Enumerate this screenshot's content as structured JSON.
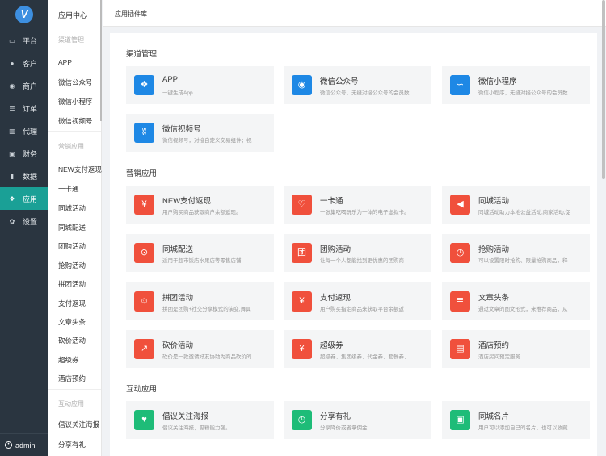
{
  "logo": {
    "text": "V"
  },
  "main_nav": [
    {
      "label": "平台",
      "icon": "monitor-icon"
    },
    {
      "label": "客户",
      "icon": "user-icon"
    },
    {
      "label": "商户",
      "icon": "users-icon"
    },
    {
      "label": "订单",
      "icon": "list-icon"
    },
    {
      "label": "代理",
      "icon": "map-icon"
    },
    {
      "label": "财务",
      "icon": "wallet-icon"
    },
    {
      "label": "数据",
      "icon": "bar-chart-icon"
    },
    {
      "label": "应用",
      "icon": "cubes-icon",
      "active": true
    },
    {
      "label": "设置",
      "icon": "gear-icon"
    }
  ],
  "user": {
    "name": "admin"
  },
  "sub_nav": {
    "title": "应用中心",
    "groups": [
      {
        "label": "渠道管理",
        "items": [
          "APP",
          "微信公众号",
          "微信小程序",
          "微信视频号"
        ]
      },
      {
        "label": "营销应用",
        "items": [
          "NEW支付返现",
          "一卡通",
          "同城活动",
          "同城配送",
          "团购活动",
          "抢购活动",
          "拼团活动",
          "支付返现",
          "文章头条",
          "砍价活动",
          "超级券",
          "酒店预约"
        ]
      },
      {
        "label": "互动应用",
        "items": [
          "倡议关注海报",
          "分享有礼"
        ]
      }
    ]
  },
  "topbar": {
    "title": "应用插件库"
  },
  "sections": [
    {
      "title": "渠道管理",
      "cards": [
        {
          "name": "APP",
          "desc": "一键生成App",
          "icon": "grid-icon",
          "color": "blue",
          "glyph": "❖"
        },
        {
          "name": "微信公众号",
          "desc": "微信公众号，无缝对接公众号的会员数",
          "icon": "wechat-icon",
          "color": "blue",
          "glyph": "◉"
        },
        {
          "name": "微信小程序",
          "desc": "微信小程序，无缝对接公众号的会员数",
          "icon": "mini-program-icon",
          "color": "blue",
          "glyph": "∽"
        },
        {
          "name": "微信视频号",
          "desc": "微信视频号，对接自定义交易组件；视",
          "icon": "channels-icon",
          "color": "blue",
          "glyph": "ʬ"
        }
      ]
    },
    {
      "title": "营销应用",
      "cards": [
        {
          "name": "NEW支付返现",
          "desc": "用户购买商品获取商户余额返现。",
          "icon": "money-bag-icon",
          "color": "red",
          "glyph": "¥"
        },
        {
          "name": "一卡通",
          "desc": "一张集吃喝玩乐为一体的电子虚拟卡。",
          "icon": "heart-card-icon",
          "color": "red",
          "glyph": "♡"
        },
        {
          "name": "同城活动",
          "desc": "同城活动助力本地公益活动,商家活动,促",
          "icon": "megaphone-icon",
          "color": "red",
          "glyph": "◀"
        },
        {
          "name": "同城配送",
          "desc": "适用于超市饭店水果店等零售店铺",
          "icon": "scooter-icon",
          "color": "red",
          "glyph": "⊙"
        },
        {
          "name": "团购活动",
          "desc": "让每一个人都能找到更优惠的团购商",
          "icon": "group-buy-icon",
          "color": "red",
          "glyph": "团"
        },
        {
          "name": "抢购活动",
          "desc": "可以设置限时抢购、限量抢购商品，释",
          "icon": "timer-icon",
          "color": "red",
          "glyph": "◷"
        },
        {
          "name": "拼团活动",
          "desc": "拼团是团购+社交分享模式的演变,舞具",
          "icon": "people-icon",
          "color": "red",
          "glyph": "☺"
        },
        {
          "name": "支付返现",
          "desc": "用户购买指定商品来获取平台余额返",
          "icon": "cash-bag-icon",
          "color": "red",
          "glyph": "¥"
        },
        {
          "name": "文章头条",
          "desc": "通过文章的图文形式，来推荐商品，从",
          "icon": "article-icon",
          "color": "red",
          "glyph": "≣"
        },
        {
          "name": "砍价活动",
          "desc": "砍价是一款邀请好友协助为商品砍价的",
          "icon": "knife-icon",
          "color": "red",
          "glyph": "↗"
        },
        {
          "name": "超级券",
          "desc": "超级券、集团级券、代金券、套餐券、",
          "icon": "coupon-icon",
          "color": "red",
          "glyph": "¥"
        },
        {
          "name": "酒店预约",
          "desc": "酒店房间预定服务",
          "icon": "hotel-icon",
          "color": "red",
          "glyph": "▤"
        }
      ]
    },
    {
      "title": "互动应用",
      "cards": [
        {
          "name": "倡议关注海报",
          "desc": "倡议关注海报，吸粉能力强。",
          "icon": "heart-icon",
          "color": "green",
          "glyph": "♥"
        },
        {
          "name": "分享有礼",
          "desc": "分享降价或者拿佣金",
          "icon": "stopwatch-icon",
          "color": "green",
          "glyph": "◷"
        },
        {
          "name": "同城名片",
          "desc": "用户可以添加自己的名片，也可以收藏",
          "icon": "id-card-icon",
          "color": "green",
          "glyph": "▣"
        }
      ]
    }
  ]
}
